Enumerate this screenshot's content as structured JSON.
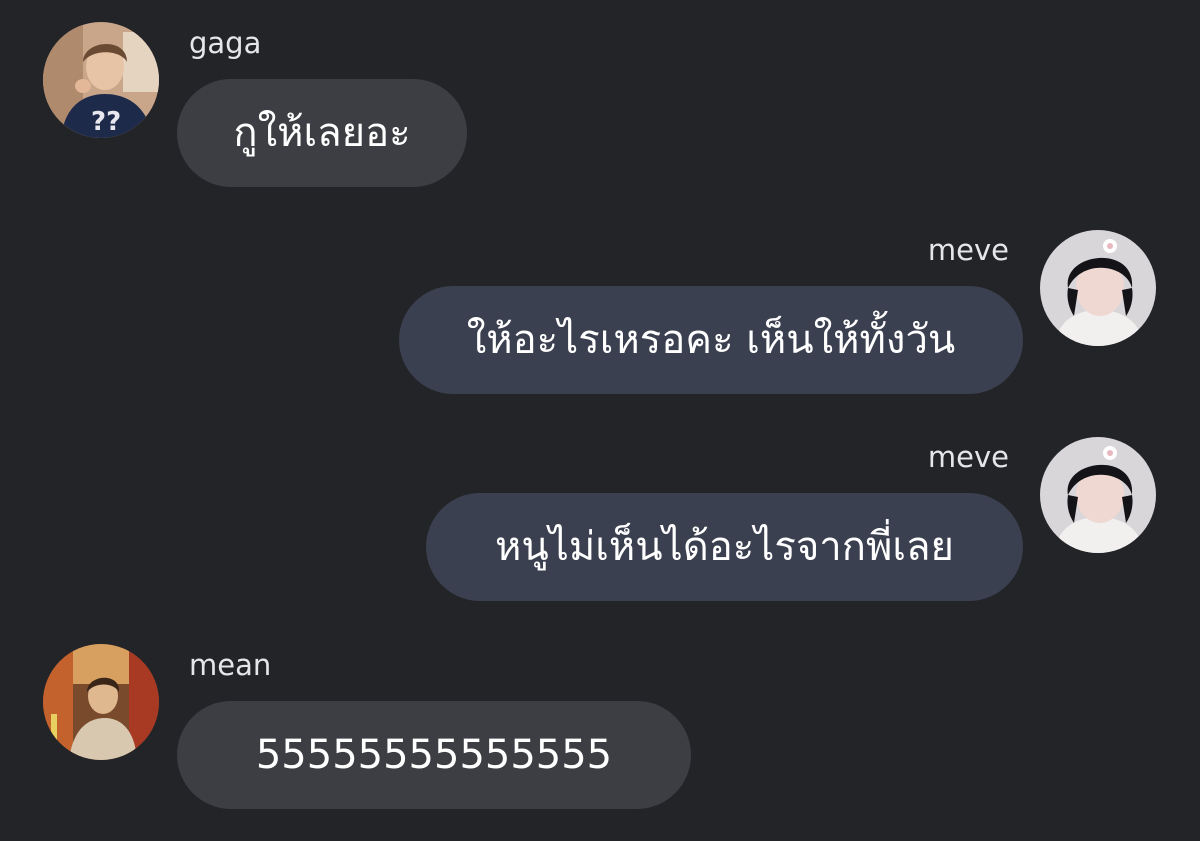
{
  "messages": [
    {
      "sender": "gaga",
      "text": "กูให้เลยอะ",
      "side": "left",
      "avatar_icon": "person-avatar-icon"
    },
    {
      "sender": "meve",
      "text": "ให้อะไรเหรอคะ เห็นให้ทั้งวัน",
      "side": "right",
      "avatar_icon": "person-avatar-icon"
    },
    {
      "sender": "meve",
      "text": "หนูไม่เห็นได้อะไรจากพี่เลย",
      "side": "right",
      "avatar_icon": "person-avatar-icon"
    },
    {
      "sender": "mean",
      "text": "55555555555555",
      "side": "left",
      "avatar_icon": "person-avatar-icon"
    }
  ],
  "colors": {
    "background": "#232428",
    "incoming_bubble": "#3d3e43",
    "outgoing_bubble": "#3b4050",
    "text": "#ffffff",
    "sender_name": "#e6e6e9"
  }
}
